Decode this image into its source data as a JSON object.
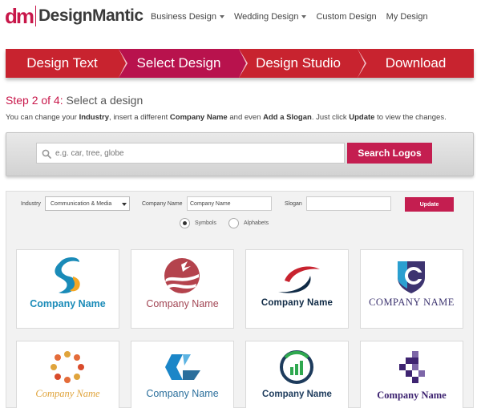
{
  "header": {
    "logo_mark": "dm",
    "logo_text": "DesignMantic",
    "nav": [
      {
        "label": "Business Design",
        "dropdown": true
      },
      {
        "label": "Wedding Design",
        "dropdown": true
      },
      {
        "label": "Custom Design",
        "dropdown": false
      },
      {
        "label": "My Design",
        "dropdown": false
      }
    ]
  },
  "steps": [
    {
      "label": "Design Text",
      "active": false
    },
    {
      "label": "Select Design",
      "active": true
    },
    {
      "label": "Design Studio",
      "active": false
    },
    {
      "label": "Download",
      "active": false
    }
  ],
  "step_heading": {
    "prefix": "Step 2 of 4:",
    "text": " Select a design"
  },
  "instructions": {
    "t1": "You can change your ",
    "b1": "Industry",
    "t2": ", insert a different ",
    "b2": "Company Name",
    "t3": " and even ",
    "b3": "Add a Slogan",
    "t4": ". Just click ",
    "b4": "Update",
    "t5": " to view the changes."
  },
  "search": {
    "placeholder": "e.g. car, tree, globe",
    "button_label": "Search Logos"
  },
  "filters": {
    "industry_label": "Industry",
    "industry_value": "Communication & Media",
    "company_label": "Company Name",
    "company_value": "Company Name",
    "slogan_label": "Slogan",
    "slogan_value": "",
    "update_label": "Update",
    "radio_symbols": "Symbols",
    "radio_alphabets": "Alphabets",
    "selected": "Symbols"
  },
  "designs": [
    {
      "name": "Company Name",
      "color": "#1a8bb8"
    },
    {
      "name": "Company Name",
      "color": "#b4434d"
    },
    {
      "name": "Company Name",
      "color": "#0f2a45"
    },
    {
      "name": "COMPANY NAME",
      "color": "#3d3470"
    },
    {
      "name": "Company Name",
      "color": "#e0a43c"
    },
    {
      "name": "Company Name",
      "color": "#2b6f9c"
    },
    {
      "name": "Company Name",
      "color": "#1d3b5c"
    },
    {
      "name": "Company Name",
      "color": "#3e2471"
    }
  ],
  "colors": {
    "brand": "#c8174a",
    "steps_bar": "#c8232f",
    "steps_active": "#b8124d",
    "button": "#c41e50"
  }
}
